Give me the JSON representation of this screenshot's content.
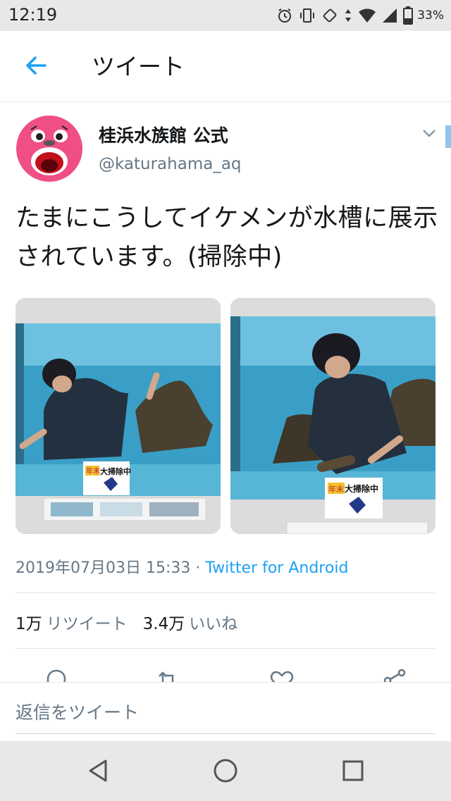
{
  "status_bar": {
    "time": "12:19",
    "battery": "33%",
    "icons": [
      "alarm-icon",
      "vibrate-icon",
      "rotate-icon",
      "data-arrows-icon",
      "wifi-icon",
      "signal-icon",
      "battery-icon"
    ]
  },
  "header": {
    "back_icon": "arrow-left-icon",
    "title": "ツイート"
  },
  "tweet": {
    "display_name": "桂浜水族館 公式",
    "handle": "@katurahama_aq",
    "text": "たまにこうしてイケメンが水槽に展示されています。(掃除中)",
    "photos": [
      {
        "sign_text": "大掃除中",
        "sign_tag": "年末"
      },
      {
        "sign_text": "大掃除中",
        "sign_tag": "年末"
      }
    ],
    "timestamp": "2019年07月03日 15:33",
    "separator": "·",
    "source": "Twitter for Android",
    "retweets_count": "1万",
    "retweets_label": "リツイート",
    "likes_count": "3.4万",
    "likes_label": "いいね"
  },
  "actions": [
    "reply-icon",
    "retweet-icon",
    "like-icon",
    "share-icon"
  ],
  "reply": {
    "placeholder": "返信をツイート"
  },
  "nav": [
    "back-triangle-icon",
    "home-circle-icon",
    "recents-square-icon"
  ],
  "colors": {
    "accent": "#1da1f2",
    "secondary_text": "#657786",
    "primary_text": "#14171a",
    "divider": "#e1e8ed",
    "system_bar": "#e8e8e8"
  }
}
